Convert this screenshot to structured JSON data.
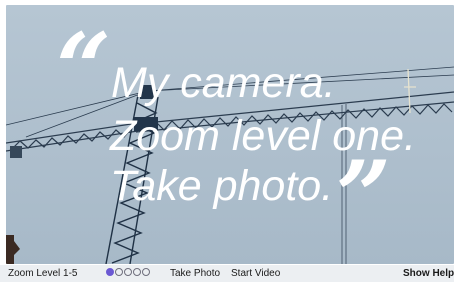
{
  "quote": {
    "open_mark": "“",
    "close_mark": "”",
    "line1": "My camera.",
    "line2": "Zoom level one.",
    "line3": "Take photo."
  },
  "toolbar": {
    "zoom_label": "Zoom Level 1-5",
    "zoom_levels": [
      1,
      2,
      3,
      4,
      5
    ],
    "zoom_current": 1,
    "take_photo_label": "Take Photo",
    "start_video_label": "Start Video",
    "show_help_label": "Show Help"
  },
  "colors": {
    "accent": "#6b59d3",
    "sky": "#b6c6d3",
    "toolbar_bg": "#eceff2",
    "crane": "#23364a"
  }
}
